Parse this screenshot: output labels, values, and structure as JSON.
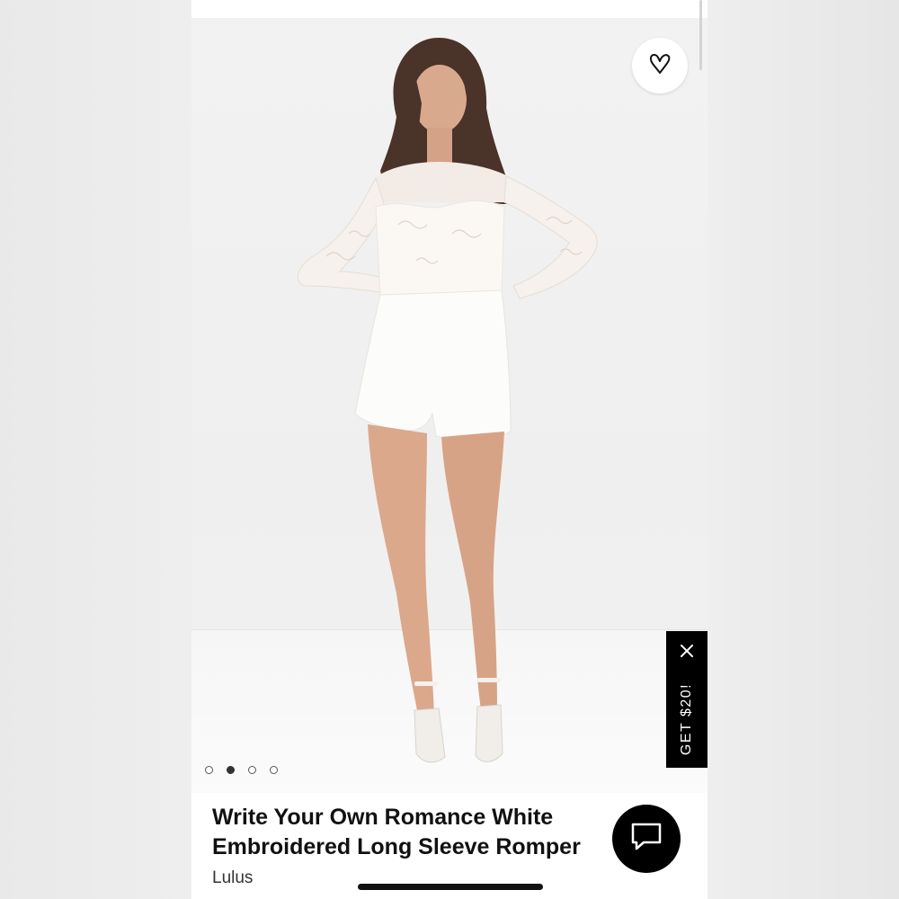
{
  "product": {
    "title": "Write Your Own Romance White Embroidered Long Sleeve Romper",
    "brand": "Lulus"
  },
  "image_carousel": {
    "total_images": 4,
    "active_index": 2
  },
  "favorite": {
    "icon": "heart-outline-icon"
  },
  "promo": {
    "label": "GET $20!",
    "close_icon": "close-icon"
  },
  "chat": {
    "icon": "chat-bubble-icon"
  },
  "colors": {
    "promo_background": "#000000",
    "chat_background": "#000000",
    "accent_text": "#111111"
  }
}
